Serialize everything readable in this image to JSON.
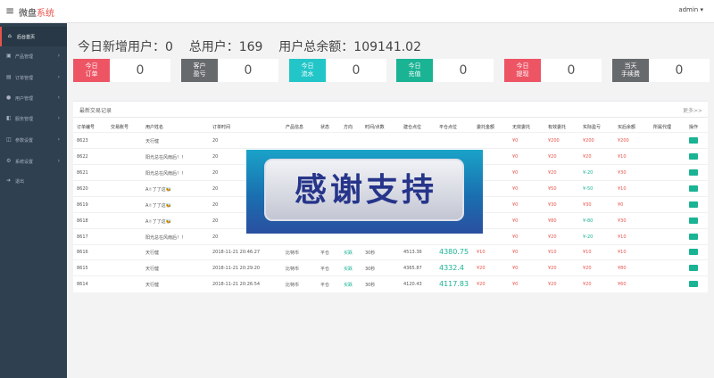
{
  "header": {
    "brand_main": "微盘",
    "brand_accent": "系统",
    "user": "admin"
  },
  "colors": {
    "accent": "#e8534c",
    "sidebar_bg": "#2f4050",
    "green": "#1ab394"
  },
  "sidebar": {
    "items": [
      {
        "icon": "home-icon",
        "label": "后台首页"
      },
      {
        "icon": "box-icon",
        "label": "产品管理"
      },
      {
        "icon": "order-icon",
        "label": "订单管理"
      },
      {
        "icon": "user-icon",
        "label": "用户管理"
      },
      {
        "icon": "service-icon",
        "label": "服务管理"
      },
      {
        "icon": "settings-icon",
        "label": "参数设置"
      },
      {
        "icon": "system-icon",
        "label": "系统设置"
      },
      {
        "icon": "logout-icon",
        "label": "退出"
      }
    ]
  },
  "stats": {
    "new_users_label": "今日新增用户：",
    "new_users": "0",
    "total_users_label": "总用户：",
    "total_users": "169",
    "balance_label": "用户总余额：",
    "balance": "109141.02"
  },
  "cards": [
    {
      "line1": "今日",
      "line2": "订单",
      "value": "0",
      "color": "#ed5565"
    },
    {
      "line1": "客户",
      "line2": "盈亏",
      "value": "0",
      "color": "#676a6c"
    },
    {
      "line1": "今日",
      "line2": "流水",
      "value": "0",
      "color": "#23c6c8"
    },
    {
      "line1": "今日",
      "line2": "充值",
      "value": "0",
      "color": "#1ab394"
    },
    {
      "line1": "今日",
      "line2": "提现",
      "value": "0",
      "color": "#ed5565"
    },
    {
      "line1": "当天",
      "line2": "手续费",
      "value": "0",
      "color": "#676a6c"
    }
  ],
  "table": {
    "title": "最新交易记录",
    "more": "更多>>",
    "headers": [
      "订单编号",
      "交易账号",
      "用户姓名",
      "订单时间",
      "产品信息",
      "状态",
      "方向",
      "时间/点数",
      "建仓点位",
      "平仓点位",
      "委托金额",
      "无效委托",
      "有效委托",
      "实际盈亏",
      "买后余额",
      "所属代理",
      "操作"
    ],
    "rows": [
      {
        "id": "8623",
        "name": "天行健",
        "time": "20",
        "amt_a": "¥0",
        "amt_b": "¥200",
        "pnl": "¥200",
        "bal": "¥200"
      },
      {
        "id": "8622",
        "name": "阳光总在风雨后！！",
        "time": "20",
        "amt_a": "¥0",
        "amt_b": "¥20",
        "pnl": "¥20",
        "bal": "¥10"
      },
      {
        "id": "8621",
        "name": "阳光总在风雨后！！",
        "time": "20",
        "amt_a": "¥0",
        "amt_b": "¥20",
        "pnl": "¥-20",
        "bal": "¥30"
      },
      {
        "id": "8620",
        "name": "A✌了了这🐝",
        "time": "20",
        "amt_a": "¥0",
        "amt_b": "¥50",
        "pnl": "¥-50",
        "bal": "¥10"
      },
      {
        "id": "8619",
        "name": "A✌了了这🐝",
        "time": "20",
        "amt_a": "¥0",
        "amt_b": "¥30",
        "pnl": "¥30",
        "bal": "¥0"
      },
      {
        "id": "8618",
        "name": "A✌了了这🐝",
        "time": "20",
        "amt_a": "¥0",
        "amt_b": "¥80",
        "pnl": "¥-80",
        "bal": "¥30"
      },
      {
        "id": "8617",
        "name": "阳光总在风雨后！！",
        "time": "20",
        "amt_a": "¥0",
        "amt_b": "¥20",
        "pnl": "¥-20",
        "bal": "¥10"
      },
      {
        "id": "8616",
        "name": "天行健",
        "time": "2018-11-21 20:46:27",
        "product": "比特币",
        "status": "平仓",
        "dir": "买跌",
        "period": "30秒",
        "open": "4513.36",
        "close": "4380.75",
        "entrust": "¥10",
        "amt_a": "¥0",
        "amt_b": "¥10",
        "pnl": "¥10",
        "bal": "¥10"
      },
      {
        "id": "8615",
        "name": "天行健",
        "time": "2018-11-21 20:29:20",
        "product": "比特币",
        "status": "平仓",
        "dir": "买跌",
        "period": "30秒",
        "open": "4365.87",
        "close": "4332.4",
        "entrust": "¥20",
        "amt_a": "¥0",
        "amt_b": "¥20",
        "pnl": "¥20",
        "bal": "¥80"
      },
      {
        "id": "8614",
        "name": "天行健",
        "time": "2018-11-21 20:26:54",
        "product": "比特币",
        "status": "平仓",
        "dir": "买跌",
        "period": "30秒",
        "open": "4120.43",
        "close": "4117.83",
        "entrust": "¥20",
        "amt_a": "¥0",
        "amt_b": "¥20",
        "pnl": "¥20",
        "bal": "¥60"
      }
    ]
  },
  "overlay": {
    "text": "感谢支持"
  }
}
